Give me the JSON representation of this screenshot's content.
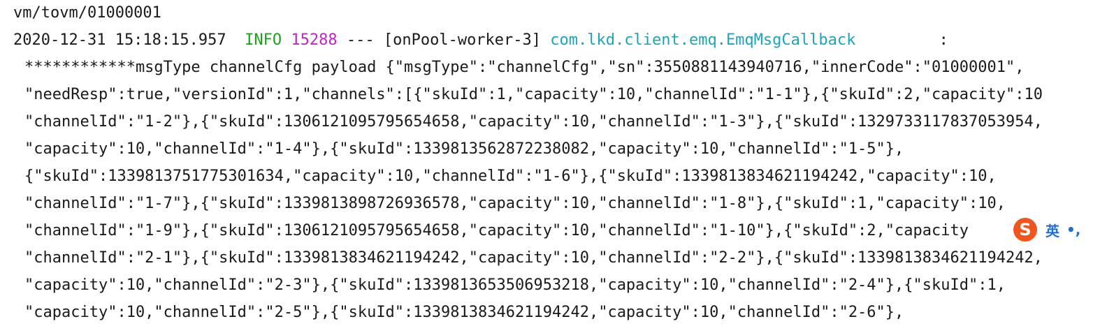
{
  "console": {
    "title_line": "vm/tovm/01000001",
    "log_header": {
      "timestamp": "2020-12-31 15:18:15.957",
      "level": "INFO",
      "pid": "15288",
      "separator": "---",
      "thread": "[onPool-worker-3]",
      "logger": "com.lkd.client.emq.EmqMsgCallback",
      "colon": ":"
    },
    "payload_lines": [
      "************msgType channelCfg payload {\"msgType\":\"channelCfg\",\"sn\":3550881143940716,\"innerCode\":\"01000001\",",
      "\"needResp\":true,\"versionId\":1,\"channels\":[{\"skuId\":1,\"capacity\":10,\"channelId\":\"1-1\"},{\"skuId\":2,\"capacity\":10",
      "\"channelId\":\"1-2\"},{\"skuId\":1306121095795654658,\"capacity\":10,\"channelId\":\"1-3\"},{\"skuId\":1329733117837053954,",
      "\"capacity\":10,\"channelId\":\"1-4\"},{\"skuId\":1339813562872238082,\"capacity\":10,\"channelId\":\"1-5\"},",
      "{\"skuId\":1339813751775301634,\"capacity\":10,\"channelId\":\"1-6\"},{\"skuId\":1339813834621194242,\"capacity\":10,",
      "\"channelId\":\"1-7\"},{\"skuId\":1339813898726936578,\"capacity\":10,\"channelId\":\"1-8\"},{\"skuId\":1,\"capacity\":10,",
      "\"channelId\":\"1-9\"},{\"skuId\":1306121095795654658,\"capacity\":10,\"channelId\":\"1-10\"},{\"skuId\":2,\"capacity",
      "\"channelId\":\"2-1\"},{\"skuId\":1339813834621194242,\"capacity\":10,\"channelId\":\"2-2\"},{\"skuId\":1339813834621194242,",
      "\"capacity\":10,\"channelId\":\"2-3\"},{\"skuId\":1339813653506953218,\"capacity\":10,\"channelId\":\"2-4\"},{\"skuId\":1,",
      "\"capacity\":10,\"channelId\":\"2-5\"},{\"skuId\":1339813834621194242,\"capacity\":10,\"channelId\":\"2-6\"},"
    ]
  },
  "ime_toolbar": {
    "logo_glyph": "S",
    "mode_label": "英",
    "punct_label": "•,",
    "brand_color": "#f2551b"
  },
  "colors": {
    "text": "#1a1a1a",
    "info_level": "#18a318",
    "pid": "#c026c0",
    "logger": "#1aa6b7"
  }
}
